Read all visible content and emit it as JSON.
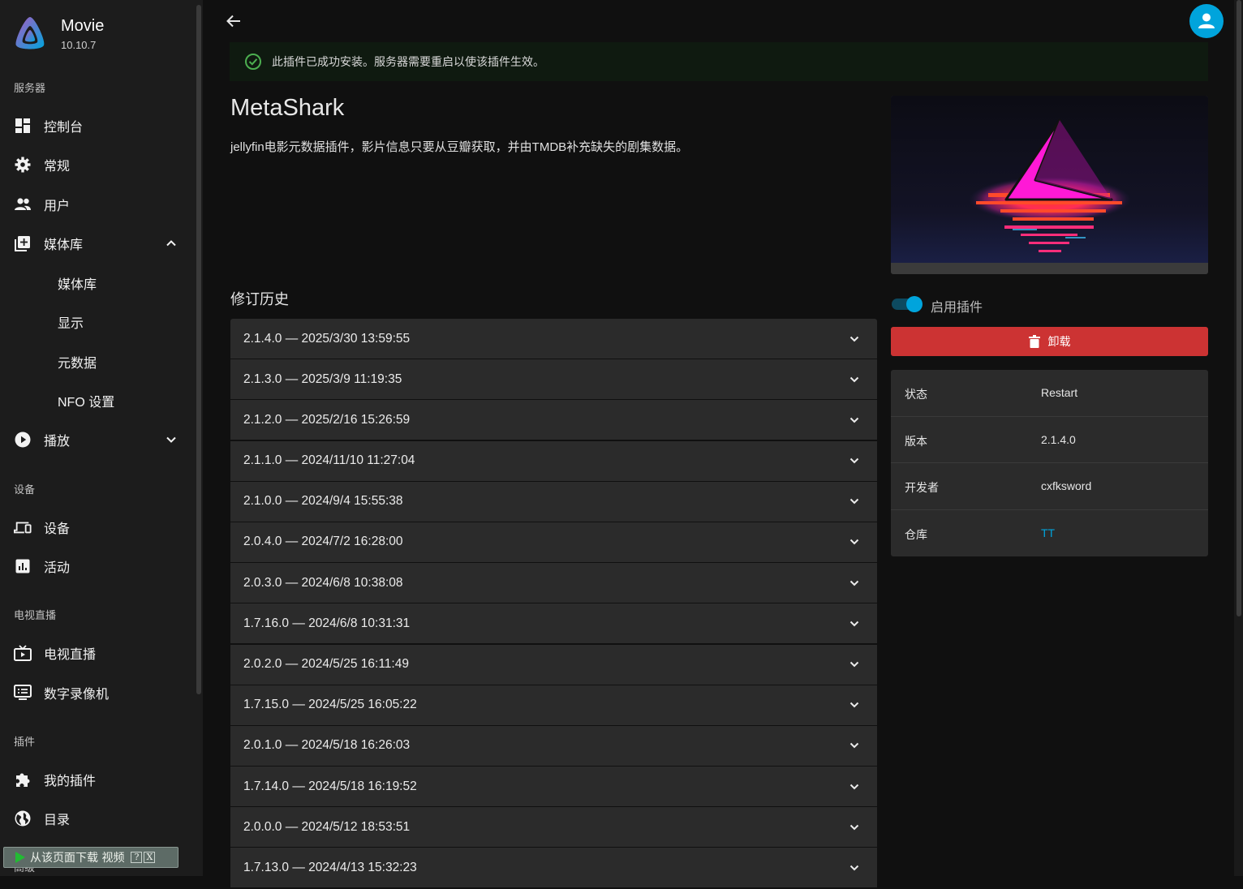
{
  "app": {
    "name": "Movie",
    "version": "10.10.7"
  },
  "sidebar": {
    "sections": {
      "server": "服务器",
      "devices": "设备",
      "livetv": "电视直播",
      "plugins": "插件",
      "advanced": "高级"
    },
    "items": {
      "dashboard": "控制台",
      "general": "常规",
      "users": "用户",
      "libraries": "媒体库",
      "libraries_sub": "媒体库",
      "display": "显示",
      "metadata": "元数据",
      "nfo": "NFO 设置",
      "playback": "播放",
      "devices": "设备",
      "activity": "活动",
      "livetv": "电视直播",
      "dvr": "数字录像机",
      "my_plugins": "我的插件",
      "catalog": "目录"
    },
    "download_bar": {
      "text": "从该页面下载 视频",
      "help": "?",
      "close": "X"
    }
  },
  "notice": {
    "message": "此插件已成功安装。服务器需要重启以使该插件生效。"
  },
  "plugin": {
    "name": "MetaShark",
    "description": "jellyfin电影元数据插件，影片信息只要从豆瓣获取，并由TMDB补充缺失的剧集数据。"
  },
  "history": {
    "title": "修订历史",
    "entries": [
      "2.1.4.0 — 2025/3/30 13:59:55",
      "2.1.3.0 — 2025/3/9 11:19:35",
      "2.1.2.0 — 2025/2/16 15:26:59",
      "2.1.1.0 — 2024/11/10 11:27:04",
      "2.1.0.0 — 2024/9/4 15:55:38",
      "2.0.4.0 — 2024/7/2 16:28:00",
      "2.0.3.0 — 2024/6/8 10:38:08",
      "1.7.16.0 — 2024/6/8 10:31:31",
      "2.0.2.0 — 2024/5/25 16:11:49",
      "1.7.15.0 — 2024/5/25 16:05:22",
      "2.0.1.0 — 2024/5/18 16:26:03",
      "1.7.14.0 — 2024/5/18 16:19:52",
      "2.0.0.0 — 2024/5/12 18:53:51",
      "1.7.13.0 — 2024/4/13 15:32:23"
    ]
  },
  "controls": {
    "enable_label": "启用插件",
    "enabled": true,
    "uninstall_label": "卸载"
  },
  "info": {
    "status_label": "状态",
    "status_value": "Restart",
    "version_label": "版本",
    "version_value": "2.1.4.0",
    "developer_label": "开发者",
    "developer_value": "cxfksword",
    "repo_label": "仓库",
    "repo_value": "TT"
  },
  "colors": {
    "accent": "#00a4dc",
    "danger": "#cc3333",
    "success": "#4caf50"
  }
}
